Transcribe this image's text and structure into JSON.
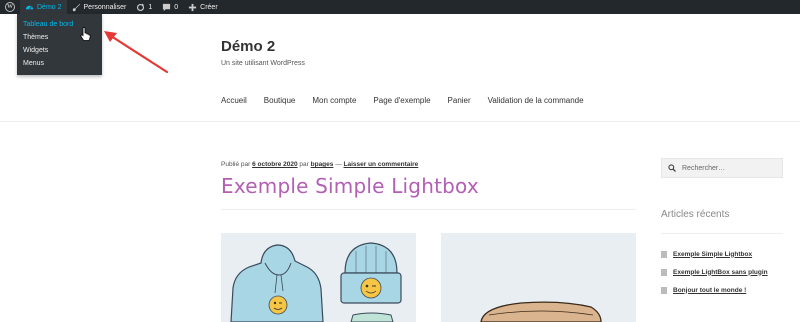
{
  "adminbar": {
    "site_name": "Démo 2",
    "customize": "Personnaliser",
    "updates_count": "1",
    "comments_count": "0",
    "new": "Créer"
  },
  "dropdown": {
    "items": [
      "Tableau de bord",
      "Thèmes",
      "Widgets",
      "Menus"
    ]
  },
  "site": {
    "title": "Démo 2",
    "tagline": "Un site utilisant WordPress"
  },
  "nav": [
    "Accueil",
    "Boutique",
    "Mon compte",
    "Page d'exemple",
    "Panier",
    "Validation de la commande"
  ],
  "post": {
    "published_prefix": "Publié par ",
    "date": "6 octobre 2020",
    "by": " par ",
    "author": "bpages",
    "sep": " — ",
    "comment_link": "Laisser un commentaire",
    "title": "Exemple Simple Lightbox"
  },
  "sidebar": {
    "search_placeholder": "Rechercher…",
    "recent_title": "Articles récents",
    "recent": [
      "Exemple Simple Lightbox",
      "Exemple LightBox sans plugin",
      "Bonjour tout le monde !"
    ]
  },
  "colors": {
    "admin_bar": "#23282d",
    "accent_blue": "#00b9eb",
    "post_title": "#b35fb3",
    "annotation_arrow": "#e53935"
  }
}
